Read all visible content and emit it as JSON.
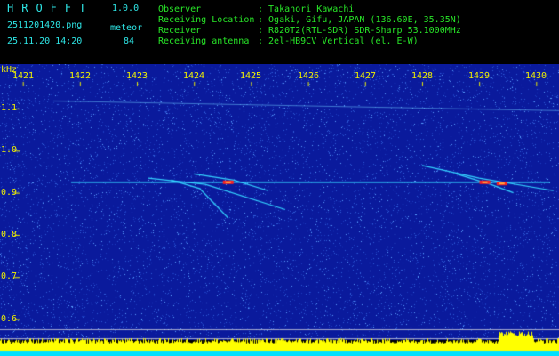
{
  "header": {
    "app_name": "HROFFT",
    "version": "1.0.0",
    "filename": "2511201420.png",
    "datetime": "25.11.20 14:20",
    "meteor_label": "meteor",
    "meteor_count": "84",
    "fields": [
      {
        "label": "Observer",
        "value": ": Takanori Kawachi"
      },
      {
        "label": "Receiving Location",
        "value": ": Ogaki, Gifu, JAPAN (136.60E, 35.35N)"
      },
      {
        "label": "Receiver",
        "value": ": R820T2(RTL-SDR) SDR-Sharp 53.1000MHz"
      },
      {
        "label": "Receiving antenna",
        "value": ": 2el-HB9CV Vertical (el. E-W)"
      }
    ]
  },
  "chart_data": {
    "type": "heatmap",
    "x_ticks": [
      "1421",
      "1422",
      "1423",
      "1424",
      "1425",
      "1426",
      "1427",
      "1428",
      "1429",
      "1430"
    ],
    "x_range": [
      1420.6,
      1430.4
    ],
    "ylabel": "kHz",
    "y_ticks": [
      "1.1",
      "1.0",
      "0.9",
      "0.8",
      "0.7",
      "0.6"
    ],
    "y_range": [
      0.58,
      1.155
    ],
    "carrier_khz": 0.925,
    "colors": {
      "background": "#0a1a9c",
      "trace": "#34d2ff",
      "hot": "#ff2020",
      "spectrum": "#ffff00",
      "text_cyan": "#2ee6e6",
      "text_green": "#28e628",
      "text_yellow": "#f0f000"
    }
  }
}
